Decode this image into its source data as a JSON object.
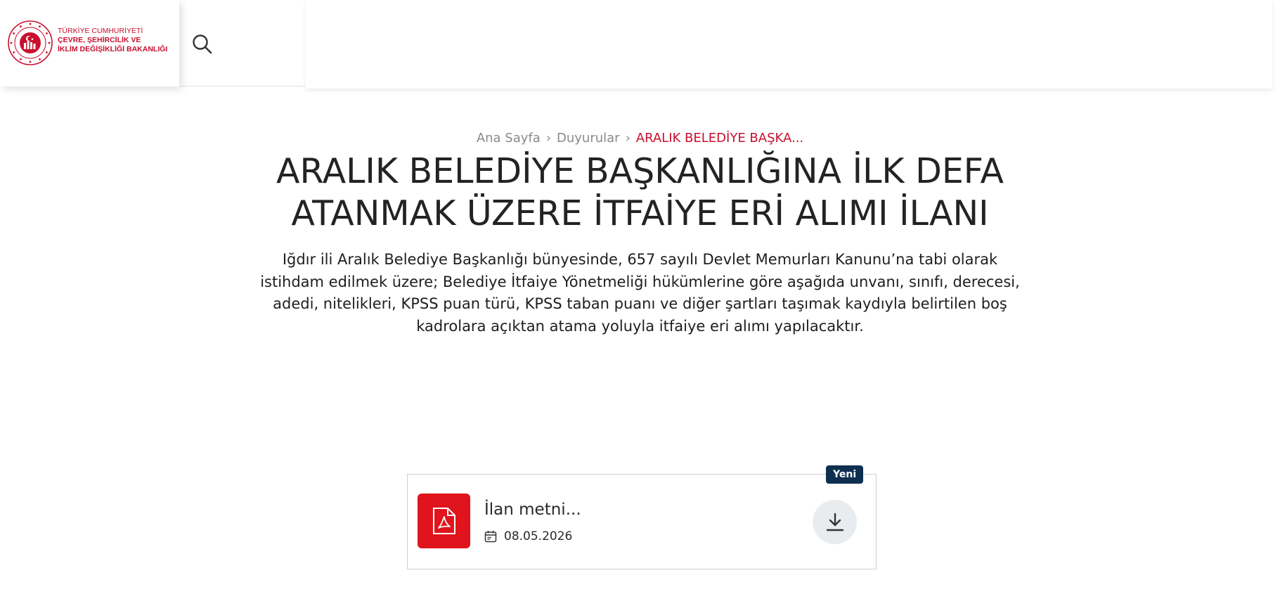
{
  "header": {
    "logo": {
      "line1": "TÜRKİYE CUMHURİYETİ",
      "line2": "ÇEVRE, ŞEHİRCİLİK VE",
      "line3": "İKLİM DEĞİŞİKLİĞİ BAKANLIĞI"
    },
    "search_icon": "search-icon",
    "brand_color": "#c8102e"
  },
  "breadcrumb": {
    "items": [
      "Ana Sayfa",
      "Duyurular"
    ],
    "current": "ARALIK BELEDİYE BAŞKA..."
  },
  "article": {
    "title_line1": "ARALIK BELEDİYE BAŞKANLIĞINA İLK DEFA",
    "title_line2": "ATANMAK ÜZERE İTFAİYE ERİ ALIMI İLANI",
    "description": "Iğdır ili Aralık Belediye Başkanlığı bünyesinde, 657 sayılı Devlet Memurları Kanunu’na tabi olarak istihdam edilmek üzere; Belediye İtfaiye Yönetmeliği hükümlerine göre aşağıda unvanı, sınıfı, derecesi, adedi, nitelikleri, KPSS puan türü, KPSS taban puanı ve diğer şartları taşımak kaydıyla belirtilen boş kadrolara açıktan atama yoluyla itfaiye eri alımı yapılacaktır."
  },
  "attachment": {
    "badge": "Yeni",
    "name": "İlan metni...",
    "date": "08.05.2026",
    "file_icon": "pdf-icon",
    "date_icon": "calendar-icon",
    "action_icon": "download-icon",
    "icon_color": "#e0141c",
    "badge_color": "#0e2f50"
  }
}
